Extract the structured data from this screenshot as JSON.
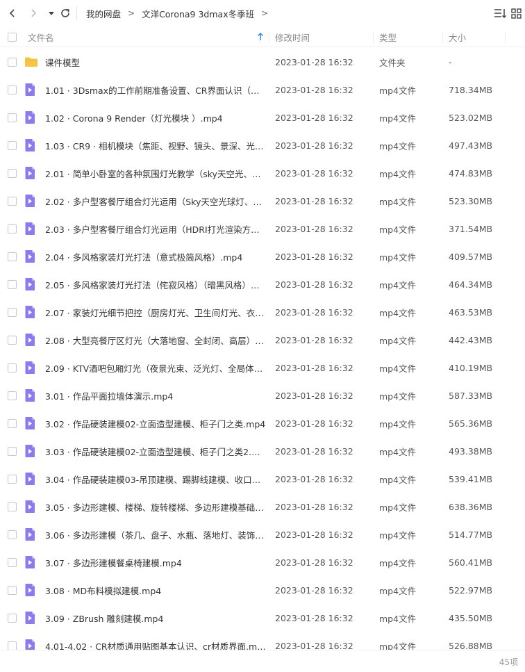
{
  "breadcrumb": [
    "我的网盘",
    "文洋Corona9 3dmax冬季班"
  ],
  "breadcrumb_separator": ">",
  "header": {
    "name": "文件名",
    "modified": "修改时间",
    "type": "类型",
    "size": "大小"
  },
  "colors": {
    "folder": "#f6c543",
    "video": "#8a7cf0",
    "sort_arrow": "#2f8cf0"
  },
  "files": [
    {
      "name": "课件模型",
      "time": "2023-01-28 16:32",
      "type": "文件夹",
      "size": "-",
      "icon": "folder-icon"
    },
    {
      "name": "1.01 · 3Dsmax的工作前期准备设置、CR界面认识（灯光…",
      "time": "2023-01-28 16:32",
      "type": "mp4文件",
      "size": "718.34MB",
      "icon": "video-file-icon"
    },
    {
      "name": "1.02 · Corona 9  Render（灯光模块 ）.mp4",
      "time": "2023-01-28 16:32",
      "type": "mp4文件",
      "size": "523.02MB",
      "icon": "video-file-icon"
    },
    {
      "name": "1.03 · CR9 · 相机模块（焦距、视野、镜头、景深、光圈…",
      "time": "2023-01-28 16:32",
      "type": "mp4文件",
      "size": "497.43MB",
      "icon": "video-file-icon"
    },
    {
      "name": "2.01 · 简单小卧室的各种氛围灯光教学（sky天空光、太…",
      "time": "2023-01-28 16:32",
      "type": "mp4文件",
      "size": "474.83MB",
      "icon": "video-file-icon"
    },
    {
      "name": "2.02 · 多户型客餐厅组合灯光运用（Sky天空光球灯、Sk…",
      "time": "2023-01-28 16:32",
      "type": "mp4文件",
      "size": "523.30MB",
      "icon": "video-file-icon"
    },
    {
      "name": "2.03 · 多户型客餐厅组合灯光运用（HDRI打光渲染方式…",
      "time": "2023-01-28 16:32",
      "type": "mp4文件",
      "size": "371.54MB",
      "icon": "video-file-icon"
    },
    {
      "name": "2.04 · 多风格家装灯光打法（意式极简风格）.mp4",
      "time": "2023-01-28 16:32",
      "type": "mp4文件",
      "size": "409.57MB",
      "icon": "video-file-icon"
    },
    {
      "name": "2.05 · 多风格家装灯光打法（侘寂风格）（暗黑风格）…",
      "time": "2023-01-28 16:32",
      "type": "mp4文件",
      "size": "464.34MB",
      "icon": "video-file-icon"
    },
    {
      "name": "2.07 · 家装灯光细节把控（厨房灯光、卫生间灯光、衣帽…",
      "time": "2023-01-28 16:32",
      "type": "mp4文件",
      "size": "463.53MB",
      "icon": "video-file-icon"
    },
    {
      "name": "2.08 · 大型亮餐厅区灯光（大落地窗、全封闭、高层）…",
      "time": "2023-01-28 16:32",
      "type": "mp4文件",
      "size": "442.43MB",
      "icon": "video-file-icon"
    },
    {
      "name": "2.09 · KTV酒吧包厢灯光（夜景光束、泛光灯、全局体积…",
      "time": "2023-01-28 16:32",
      "type": "mp4文件",
      "size": "410.19MB",
      "icon": "video-file-icon"
    },
    {
      "name": "3.01 · 作品平面拉墙体演示.mp4",
      "time": "2023-01-28 16:32",
      "type": "mp4文件",
      "size": "587.33MB",
      "icon": "video-file-icon"
    },
    {
      "name": "3.02 · 作品硬装建模02-立面造型建模、柜子门之类.mp4",
      "time": "2023-01-28 16:32",
      "type": "mp4文件",
      "size": "565.36MB",
      "icon": "video-file-icon"
    },
    {
      "name": "3.03 · 作品硬装建模02-立面造型建模、柜子门之类2.mp4",
      "time": "2023-01-28 16:32",
      "type": "mp4文件",
      "size": "493.38MB",
      "icon": "video-file-icon"
    },
    {
      "name": "3.04 · 作品硬装建模03-吊顶建模、踢脚线建模、收口细…",
      "time": "2023-01-28 16:32",
      "type": "mp4文件",
      "size": "539.41MB",
      "icon": "video-file-icon"
    },
    {
      "name": "3.05 · 多边形建模、楼梯、旋转楼梯、多边形建模基础…",
      "time": "2023-01-28 16:32",
      "type": "mp4文件",
      "size": "638.36MB",
      "icon": "video-file-icon"
    },
    {
      "name": "3.06 · 多边形建模（茶几、盘子、水瓶、落地灯、装饰）…",
      "time": "2023-01-28 16:32",
      "type": "mp4文件",
      "size": "514.77MB",
      "icon": "video-file-icon"
    },
    {
      "name": "3.07 · 多边形建模餐桌椅建模.mp4",
      "time": "2023-01-28 16:32",
      "type": "mp4文件",
      "size": "560.41MB",
      "icon": "video-file-icon"
    },
    {
      "name": "3.08 · MD布料模拟建模.mp4",
      "time": "2023-01-28 16:32",
      "type": "mp4文件",
      "size": "522.97MB",
      "icon": "video-file-icon"
    },
    {
      "name": "3.09 · ZBrush 雕刻建模.mp4",
      "time": "2023-01-28 16:32",
      "type": "mp4文件",
      "size": "435.50MB",
      "icon": "video-file-icon"
    },
    {
      "name": "4.01-4.02 · CR材质通用贴图基本认识、cr材质界面.mp4",
      "time": "2023-01-28 16:32",
      "type": "mp4文件",
      "size": "526.88MB",
      "icon": "video-file-icon"
    }
  ],
  "footer": {
    "count": "45项"
  }
}
